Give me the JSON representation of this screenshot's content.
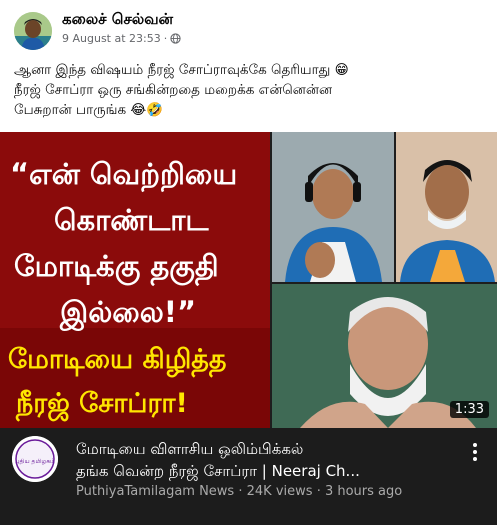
{
  "post": {
    "author": "கலைச் செல்வன்",
    "timestamp": "9 August at 23:53",
    "separator": "·",
    "audience_icon": "globe-icon",
    "text_lines": [
      "ஆனா இந்த விஷயம் நீரஜ் சோப்ராவுக்கே தெரியாது 😁",
      "நீரஜ் சோப்ரா ஒரு சங்கின்றதை மறைக்க என்னென்ன",
      "பேசுறான் பாருங்க 😂🤣"
    ]
  },
  "thumbnail": {
    "quote_lines": [
      "“என் வெற்றியை",
      "கொண்டாட",
      "மோடிக்கு தகுதி",
      "இல்லை!”"
    ],
    "tagline_lines": [
      "மோடியை கிழித்த",
      "நீரஜ் சோப்ரா!"
    ],
    "duration": "1:33"
  },
  "video": {
    "title_line1": "மோடியை விளாசிய ஒலிம்பிக்கல்",
    "title_line2": "தங்க வென்ற நீரஜ் சோப்ரா | Neeraj Ch...",
    "channel": "PuthiyaTamilagam News",
    "views": "24K views",
    "age": "3 hours ago",
    "channel_logo_text": "புதிய தமிழகம்"
  },
  "colors": {
    "thumb_red": "#8b0b0b",
    "quote_white": "#ffffff",
    "tagline_yellow": "#ffe600",
    "footer_bg": "#1c1c1c",
    "meta_grey": "#65676b"
  }
}
